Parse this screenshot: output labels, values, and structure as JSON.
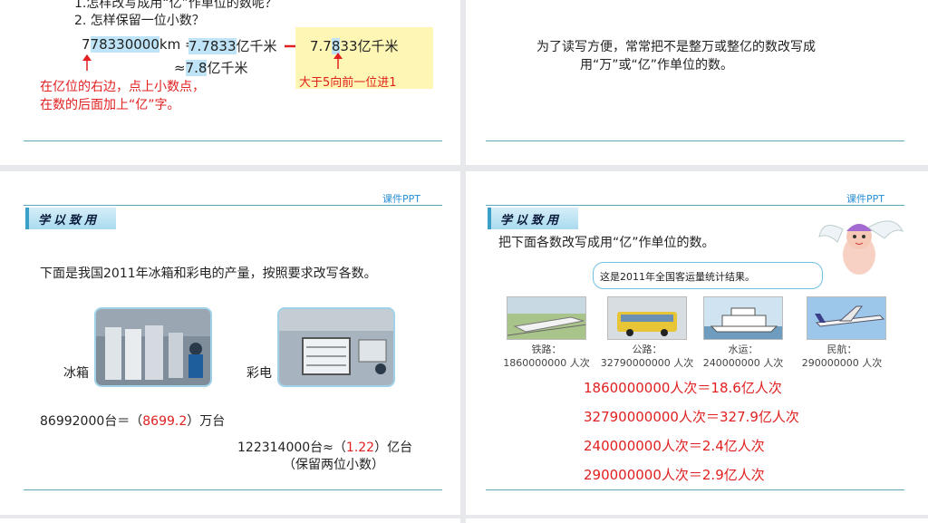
{
  "panel1": {
    "q1": "1.怎样改写成用“亿”作单位的数呢？",
    "q2": "2.  怎样保留一位小数？",
    "num_lead": "7",
    "num_hl": "78330000",
    "num_tail": "km =",
    "res_hl": "7.7833",
    "res_unit": "亿千米",
    "box_a": "7.7",
    "box_b": "8",
    "box_c": "33亿千米",
    "approx_sym": "≈",
    "approx_hl": "7.8",
    "approx_unit": "亿千米",
    "note_line1": "在亿位的右边，点上小数点，",
    "note_line2": "在数的后面加上“亿”字。",
    "round_note": "大于5向前一位进1"
  },
  "panel2": {
    "line1": "为了读写方便，常常把不是整万或整亿的数改写成",
    "line2": "用“万”或“亿”作单位的数。"
  },
  "panel3": {
    "brand": "课件PPT",
    "tag": "学以致用",
    "intro": "下面是我国2011年冰箱和彩电的产量，按照要求改写各数。",
    "label_fridge": "冰箱",
    "label_tv": "彩电",
    "eq1_prefix": "86992000台＝（",
    "eq1_answer": "8699.2",
    "eq1_suffix": "）万台",
    "eq2_prefix": "122314000台≈（",
    "eq2_answer": "1.22",
    "eq2_suffix": "）亿台",
    "eq2_note": "（保留两位小数）"
  },
  "panel4": {
    "brand": "课件PPT",
    "tag": "学以致用",
    "intro": "把下面各数改写成用“亿”作单位的数。",
    "bubble": "这是2011年全国客运量统计结果。",
    "transport": [
      {
        "label": "铁路：",
        "value": "1860000000 人次"
      },
      {
        "label": "公路：",
        "value": "32790000000 人次"
      },
      {
        "label": "水运：",
        "value": "240000000 人次"
      },
      {
        "label": "民航：",
        "value": "290000000 人次"
      }
    ],
    "answers": [
      "1860000000人次＝18.6亿人次",
      "32790000000人次＝327.9亿人次",
      "240000000人次＝2.4亿人次",
      "290000000人次＝2.9亿人次"
    ]
  }
}
